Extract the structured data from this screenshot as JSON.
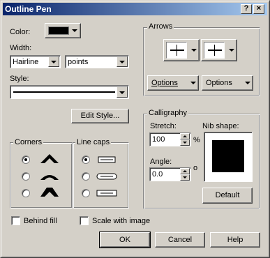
{
  "window": {
    "title": "Outline Pen",
    "help_btn": "?",
    "close_btn": "×"
  },
  "color": {
    "label": "Color:",
    "swatch": "#000000"
  },
  "width": {
    "label": "Width:",
    "value": "Hairline",
    "unit": "points"
  },
  "style": {
    "label": "Style:",
    "edit_button": "Edit Style..."
  },
  "arrows": {
    "title": "Arrows",
    "options_left": "Options",
    "options_right": "Options"
  },
  "corners": {
    "title": "Corners",
    "selected_index": 0
  },
  "line_caps": {
    "title": "Line caps",
    "selected_index": 0
  },
  "calligraphy": {
    "title": "Calligraphy",
    "stretch_label": "Stretch:",
    "stretch_value": "100",
    "stretch_unit": "%",
    "angle_label": "Angle:",
    "angle_value": "0.0",
    "angle_unit": "o",
    "nib_label": "Nib shape:",
    "default_button": "Default"
  },
  "checkboxes": {
    "behind_fill": "Behind fill",
    "scale_with_image": "Scale with image"
  },
  "buttons": {
    "ok": "OK",
    "cancel": "Cancel",
    "help": "Help"
  }
}
